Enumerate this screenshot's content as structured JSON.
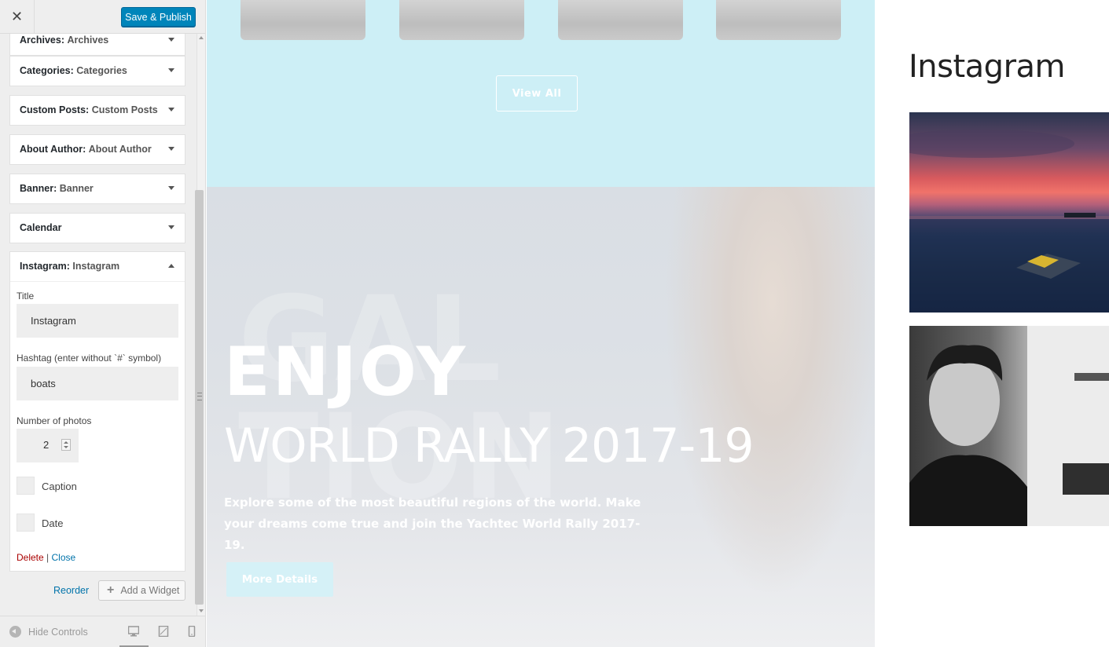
{
  "toolbar": {
    "close_label": "✕",
    "save_label": "Save & Publish"
  },
  "colors": {
    "accent": "#0085ba",
    "sidebar_bg": "#eeeeee",
    "gallery_band": "#cdeff6",
    "delete": "#aa0000",
    "link": "#0073aa"
  },
  "sidebar": {
    "sections": [
      {
        "title": "Archives",
        "subtitle": "Archives"
      },
      {
        "title": "Categories",
        "subtitle": "Categories"
      },
      {
        "title": "Custom Posts",
        "subtitle": "Custom Posts"
      },
      {
        "title": "About Author",
        "subtitle": "About Author"
      },
      {
        "title": "Banner",
        "subtitle": "Banner"
      },
      {
        "title": "Calendar",
        "subtitle": ""
      }
    ],
    "widget": {
      "title": "Instagram",
      "subtitle": "Instagram",
      "fields": {
        "title_label": "Title",
        "title_value": "Instagram",
        "hashtag_label": "Hashtag (enter without `#` symbol)",
        "hashtag_value": "boats",
        "photos_label": "Number of photos",
        "photos_value": "2",
        "caption_label": "Caption",
        "date_label": "Date"
      },
      "actions": {
        "delete": "Delete",
        "separator": "|",
        "close": "Close"
      }
    },
    "reorder": "Reorder",
    "add_widget": "Add a Widget",
    "footer": {
      "hide_controls": "Hide Controls"
    }
  },
  "preview": {
    "view_all": "View All",
    "hero": {
      "ghost_text": "GAL\nTION",
      "headline": "ENJOY",
      "subheadline": "WORLD RALLY 2017-19",
      "description": "Explore some of the most beautiful regions of the world. Make your dreams come true and join the Yachtec World Rally 2017-19.",
      "button": "More Details"
    },
    "instagram": {
      "title": "Instagram"
    }
  }
}
